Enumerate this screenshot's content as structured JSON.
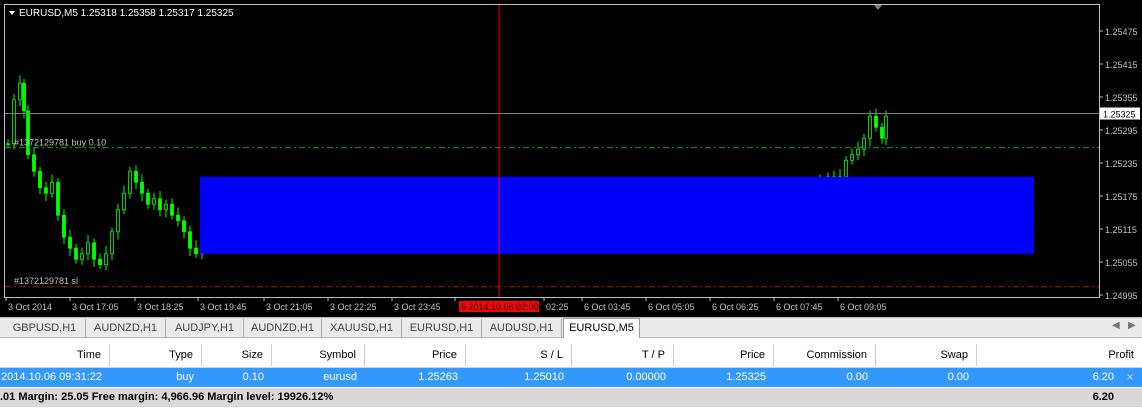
{
  "chart": {
    "header": "EURUSD,M5  1.25318 1.25358 1.25317 1.25325",
    "order_label": "#1372129781 buy 0.10",
    "sl_label": "#1372129781 sl",
    "price_scale": [
      "1.25475",
      "1.25415",
      "1.25355",
      "1.25325",
      "1.25295",
      "1.25235",
      "1.25175",
      "1.25115",
      "1.25055",
      "1.24995"
    ],
    "current_price": "1.25325",
    "time_labels": [
      "3 Oct 2014",
      "3 Oct 17:05",
      "3 Oct 18:25",
      "3 Oct 19:45",
      "3 Oct 21:05",
      "3 Oct 22:25",
      "3 Oct 23:45",
      "6 2014.10.06 02:00",
      "02:25",
      "6 Oct 03:45",
      "6 Oct 05:05",
      "6 Oct 06:25",
      "6 Oct 07:45",
      "6 Oct 09:05"
    ],
    "cursor_time": "2014.10.06 02:00",
    "colors": {
      "background": "#000000",
      "candle": "#00ff00",
      "rectangle": "#0000ff",
      "order_line": "#00aa00",
      "sl_line": "#cc0000",
      "crosshair": "#ff0000",
      "grid_text": "#c0c0c0"
    }
  },
  "tabs": {
    "items": [
      "GBPUSD,H1",
      "AUDNZD,H1",
      "AUDJPY,H1",
      "AUDNZD,H1",
      "XAUUSD,H1",
      "EURUSD,H1",
      "AUDUSD,H1",
      "EURUSD,M5"
    ],
    "active": "EURUSD,M5",
    "scroll_left": "◀",
    "scroll_right": "▶"
  },
  "trade": {
    "columns": [
      "Time",
      "Type",
      "Size",
      "Symbol",
      "Price",
      "S / L",
      "T / P",
      "Price",
      "Commission",
      "Swap",
      "Profit"
    ],
    "order": [
      "2014.10.06 09:31:22",
      "buy",
      "0.10",
      "eurusd",
      "1.25263",
      "1.25010",
      "0.00000",
      "1.25325",
      "0.00",
      "0.00",
      "6.20"
    ],
    "close_icon": "×",
    "summary_text": ".01  Margin: 25.05  Free margin: 4,966.96  Margin level: 19926.12%",
    "summary_profit": "6.20"
  }
}
